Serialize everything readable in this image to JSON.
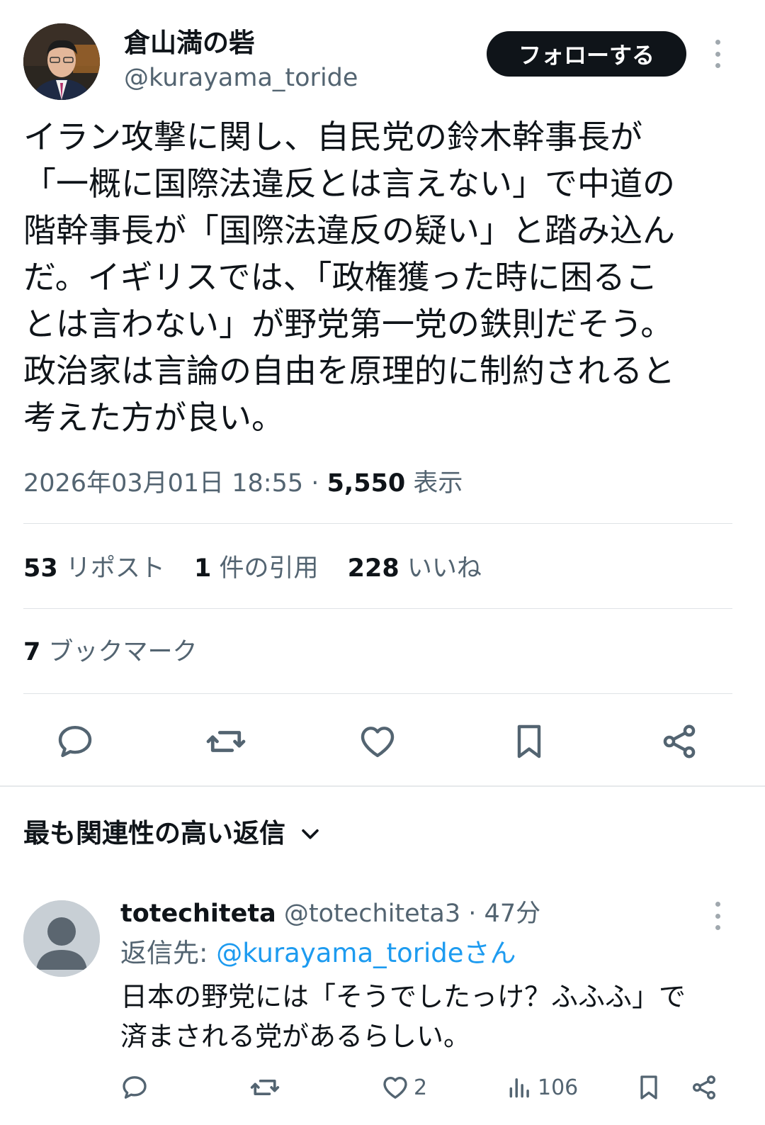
{
  "tweet": {
    "display_name": "倉山満の砦",
    "handle": "@kurayama_toride",
    "follow_label": "フォローする",
    "text_lines": [
      "イラン攻撃に関し、自民党の鈴木幹事長が",
      "「一概に国際法違反とは言えない」で中道の",
      "階幹事長が「国際法違反の疑い」と踏み込ん",
      "だ。イギリスでは、「政権獲った時に困るこ",
      "とは言わない」が野党第一党の鉄則だそう。",
      "政治家は言論の自由を原理的に制約されると",
      "考えた方が良い。"
    ],
    "timestamp": "2026年03月01日 18:55",
    "separator": "·",
    "views_count": "5,550",
    "views_label": "表示",
    "stats": {
      "reposts_count": "53",
      "reposts_label": "リポスト",
      "quotes_count": "1",
      "quotes_label": "件の引用",
      "likes_count": "228",
      "likes_label": "いいね"
    },
    "bookmarks_count": "7",
    "bookmarks_label": "ブックマーク"
  },
  "replies_header": {
    "label": "最も関連性の高い返信"
  },
  "reply": {
    "display_name": "totechiteta",
    "handle": "@totechiteta3",
    "separator": "·",
    "time": "47分",
    "reply_to_label": "返信先:",
    "reply_to_mention": "@kurayama_torideさん",
    "text_lines": [
      "日本の野党には「そうでしたっけ？ふふふ」で",
      "済まされる党があるらしい。"
    ],
    "likes_count": "2",
    "views_count": "106"
  },
  "icons": {
    "reply": "reply-icon",
    "retweet": "retweet-icon",
    "like": "heart-icon",
    "bookmark": "bookmark-icon",
    "share": "share-icon",
    "more": "more-vertical-icon",
    "dropdown": "chevron-down-icon",
    "views": "views-chart-icon"
  },
  "colors": {
    "text": "#0f1419",
    "secondary": "#536471",
    "link": "#1d9bf0",
    "follow_button": "#0f1419"
  }
}
